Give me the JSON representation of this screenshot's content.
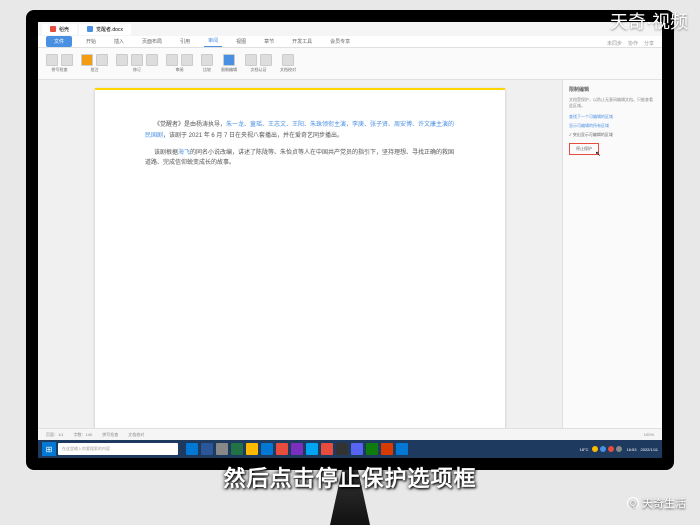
{
  "watermarks": {
    "topRight": "天奇·视频",
    "bottomRight": "天奇生活"
  },
  "subtitle": "然后点击停止保护选项框",
  "tabs": [
    {
      "label": "稻壳"
    },
    {
      "label": "觉醒者.docx"
    }
  ],
  "ribbon": {
    "file": "文件",
    "items": [
      "开始",
      "插入",
      "页面布局",
      "引用",
      "审阅",
      "视图",
      "章节",
      "开发工具",
      "会员专享"
    ],
    "active": "审阅",
    "right": [
      "未同步",
      "协作",
      "分享"
    ]
  },
  "toolGroups": [
    {
      "label": "拼写检查"
    },
    {
      "label": "批注"
    },
    {
      "label": "修订"
    },
    {
      "label": "审阅"
    },
    {
      "label": "比较"
    },
    {
      "label": "限制编辑"
    },
    {
      "label": "文档认证"
    },
    {
      "label": "文档校对"
    }
  ],
  "doc": {
    "p1a": "《觉醒者》是由杨涛执导，",
    "p1b": "朱一龙、童瑶、王志文、王阳、朱珠领衔主演，李庚、张子贤、周安博、许文康主演的民国剧",
    "p1c": "，该剧于 2021 年 6 月 7 日在央视八套播出，并在爱奇艺同步播出。",
    "p2a": "该剧根据",
    "p2b": "海飞",
    "p2c": "的同名小说改编，讲述了陈陇等、朱怡贞等人在中国共产党员的指引下，坚持理想、寻找正确的救国道路、完成信仰蜕变成长的故事。"
  },
  "panel": {
    "title": "限制编辑",
    "desc": "文档受保护，以防止无意间编辑文档。只能查看此区域。",
    "option1": "查找下一个可编辑的区域",
    "option2": "显示可编辑的所有区域",
    "check": "✓ 突出显示可编辑的区域",
    "button": "停止保护"
  },
  "status": {
    "left": [
      "页面：1/1",
      "字数：140",
      "拼写检查",
      "文档校对"
    ],
    "right": [
      "100%"
    ]
  },
  "taskbar": {
    "search": "在这里输入你要搜索的内容",
    "iconColors": [
      "#0078d4",
      "#2b579a",
      "#888",
      "#217346",
      "#ffb900",
      "#0078d4",
      "#e74c3c",
      "#7b2fbf",
      "#00a4ef",
      "#e74c3c",
      "#333",
      "#5865f2",
      "#107c10",
      "#d83b01",
      "#0078d4"
    ],
    "trayColors": [
      "#ffb900",
      "#4a90e2",
      "#e74c3c",
      "#888"
    ],
    "weather": "18°C",
    "time": "16:53",
    "date": "2022/1/11"
  }
}
